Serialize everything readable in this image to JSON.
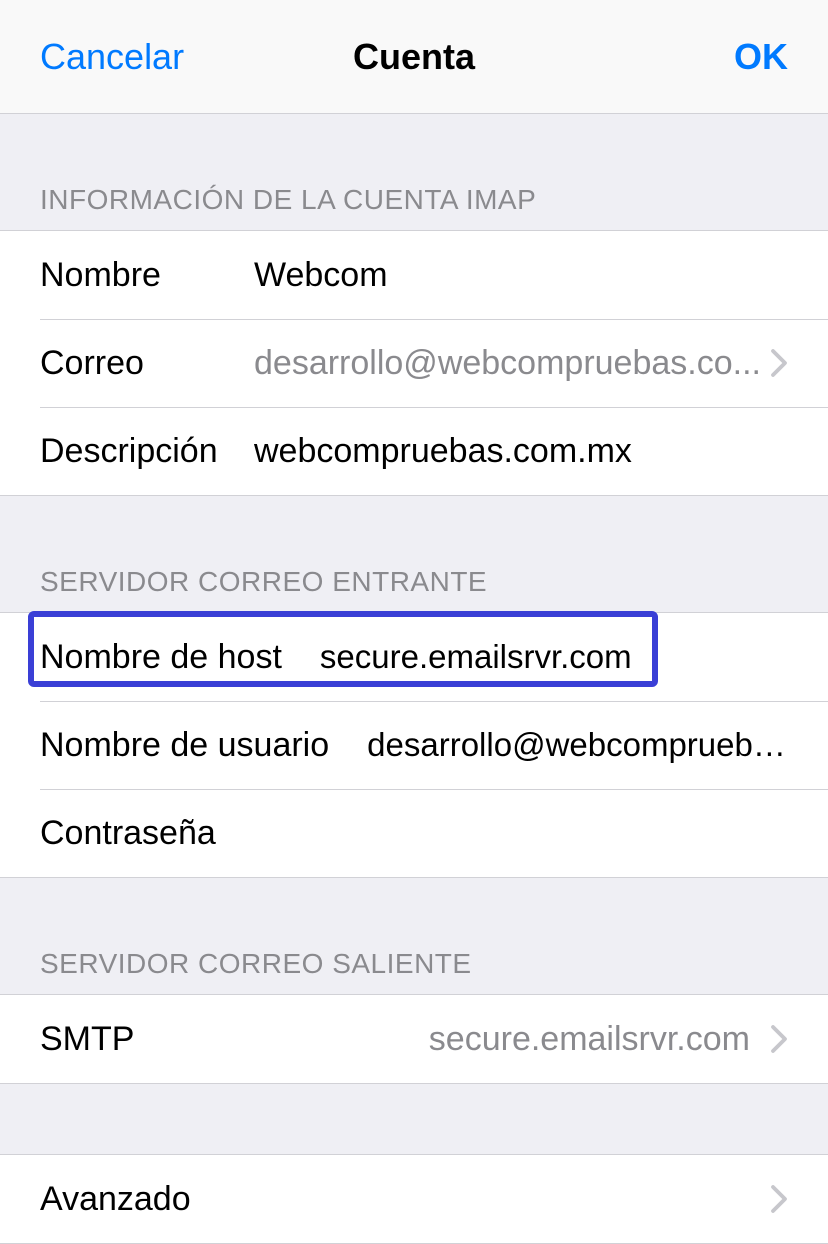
{
  "navbar": {
    "cancel": "Cancelar",
    "title": "Cuenta",
    "ok": "OK"
  },
  "sections": {
    "imap": {
      "header": "Información de la cuenta IMAP",
      "name_label": "Nombre",
      "name_value": "Webcom",
      "mail_label": "Correo",
      "mail_value": "desarrollo@webcompruebas.co...",
      "desc_label": "Descripción",
      "desc_value": "webcompruebas.com.mx"
    },
    "incoming": {
      "header": "Servidor correo entrante",
      "host_label": "Nombre de host",
      "host_value": "secure.emailsrvr.com",
      "user_label": "Nombre de usuario",
      "user_value": "desarrollo@webcompruebas.co...",
      "pass_label": "Contraseña"
    },
    "outgoing": {
      "header": "Servidor correo saliente",
      "smtp_label": "SMTP",
      "smtp_value": "secure.emailsrvr.com"
    },
    "advanced": {
      "label": "Avanzado"
    }
  }
}
